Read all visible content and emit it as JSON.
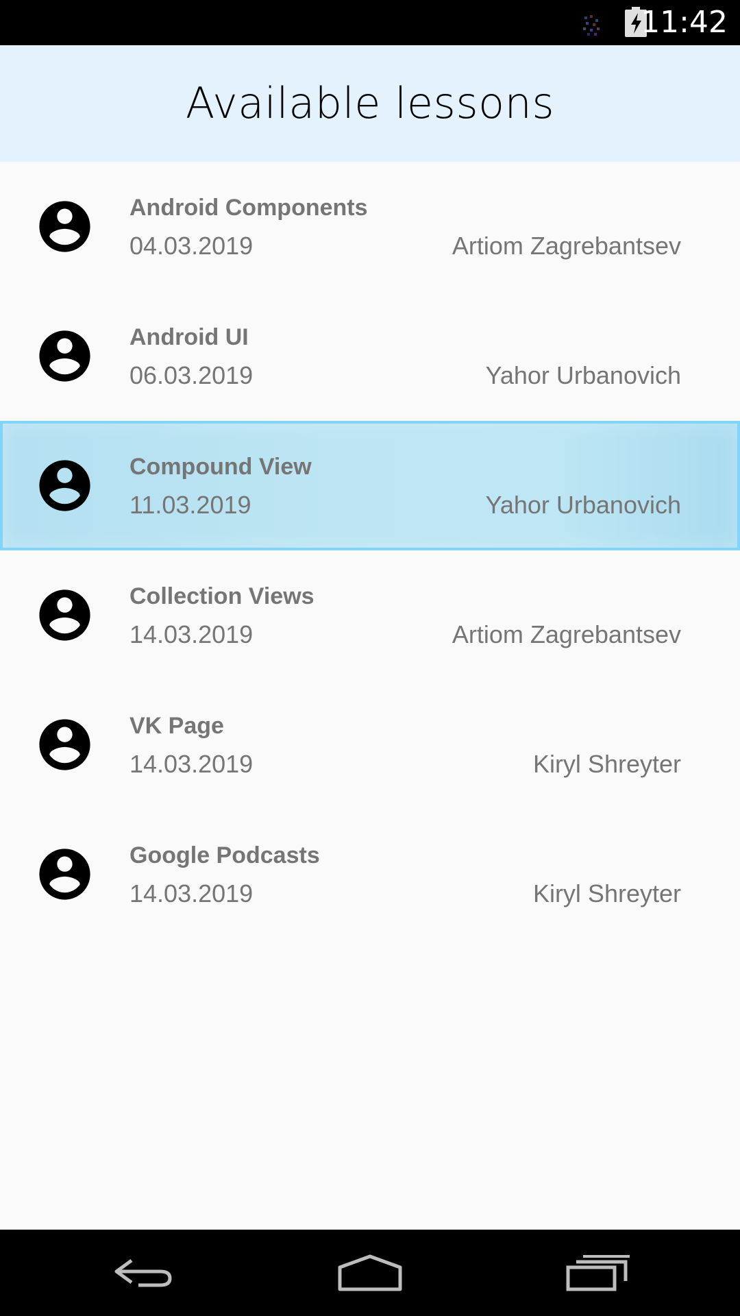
{
  "status_bar": {
    "time": "11:42",
    "icons": [
      "notification-icon",
      "battery-charging-icon"
    ]
  },
  "header": {
    "title": "Available lessons",
    "background_color": "#e3f2fd"
  },
  "lessons": [
    {
      "title": "Android Components",
      "date": "04.03.2019",
      "author": "Artiom Zagrebantsev",
      "icon": "account-circle-icon",
      "selected": false
    },
    {
      "title": "Android UI",
      "date": "06.03.2019",
      "author": "Yahor Urbanovich",
      "icon": "account-circle-icon",
      "selected": false
    },
    {
      "title": "Compound View",
      "date": "11.03.2019",
      "author": "Yahor Urbanovich",
      "icon": "account-circle-icon",
      "selected": true
    },
    {
      "title": "Collection Views",
      "date": "14.03.2019",
      "author": "Artiom Zagrebantsev",
      "icon": "account-circle-icon",
      "selected": false
    },
    {
      "title": "VK Page",
      "date": "14.03.2019",
      "author": "Kiryl Shreyter",
      "icon": "account-circle-icon",
      "selected": false
    },
    {
      "title": "Google Podcasts",
      "date": "14.03.2019",
      "author": "Kiryl Shreyter",
      "icon": "account-circle-icon",
      "selected": false
    }
  ],
  "navigation_bar": {
    "buttons": [
      "back-icon",
      "home-icon",
      "recents-icon"
    ]
  },
  "colors": {
    "selected_row": "#bde5f3",
    "selected_border": "#81d4fa",
    "text": "#757575"
  }
}
